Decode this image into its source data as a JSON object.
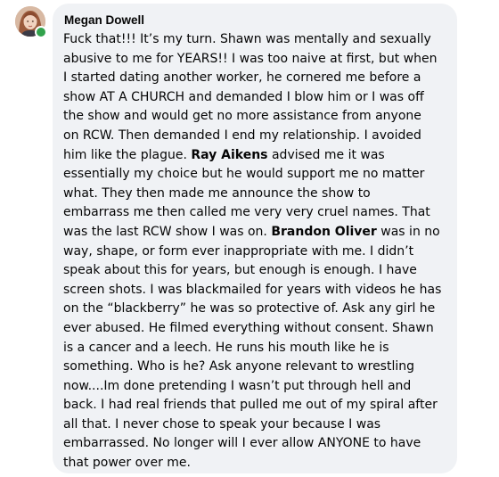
{
  "comment": {
    "author": "Megan Dowell",
    "avatar_icon": "profile-photo",
    "online_status": "online",
    "online_color": "#31a24c",
    "bubble_color": "#f0f2f5",
    "mentions": [
      "Ray Aikens",
      "Brandon Oliver"
    ],
    "lines": [
      [
        {
          "t": "Fuck that!!! It’s my turn. Shawn was mentally and sexually"
        }
      ],
      [
        {
          "t": "abusive to me for YEARS!! I was too naive at first, but when"
        }
      ],
      [
        {
          "t": "I started dating another worker, he cornered me before a"
        }
      ],
      [
        {
          "t": "show AT A CHURCH and demanded I blow him or I was off"
        }
      ],
      [
        {
          "t": "the show and would get no more assistance from anyone"
        }
      ],
      [
        {
          "t": "on RCW. Then demanded I end my relationship. I avoided"
        }
      ],
      [
        {
          "t": "him like the plague. "
        },
        {
          "t": "Ray Aikens",
          "b": true
        },
        {
          "t": " advised me it was"
        }
      ],
      [
        {
          "t": "essentially my choice but he would support me no matter"
        }
      ],
      [
        {
          "t": "what. They then made me announce the show to"
        }
      ],
      [
        {
          "t": "embarrass me then called me very very cruel names. That"
        }
      ],
      [
        {
          "t": "was the last RCW show I was on. "
        },
        {
          "t": "Brandon Oliver",
          "b": true
        },
        {
          "t": " was in no"
        }
      ],
      [
        {
          "t": "way, shape, or form ever inappropriate with me. I didn’t"
        }
      ],
      [
        {
          "t": "speak about this for years, but enough is enough. I have"
        }
      ],
      [
        {
          "t": "screen shots. I was blackmailed for years with videos he has"
        }
      ],
      [
        {
          "t": "on the “blackberry” he was so protective of. Ask any girl he"
        }
      ],
      [
        {
          "t": "ever abused. He filmed everything without consent. Shawn"
        }
      ],
      [
        {
          "t": "is a cancer and a leech. He runs his mouth like he is"
        }
      ],
      [
        {
          "t": "something. Who is he? Ask anyone relevant to wrestling"
        }
      ],
      [
        {
          "t": "now....Im done pretending I wasn’t put through hell and"
        }
      ],
      [
        {
          "t": "back. I had real friends that pulled me out of my spiral after"
        }
      ],
      [
        {
          "t": "all that. I never chose to speak your because I was"
        }
      ],
      [
        {
          "t": "embarrassed. No longer will I ever allow ANYONE to have"
        }
      ],
      [
        {
          "t": "that power over me."
        }
      ]
    ]
  }
}
